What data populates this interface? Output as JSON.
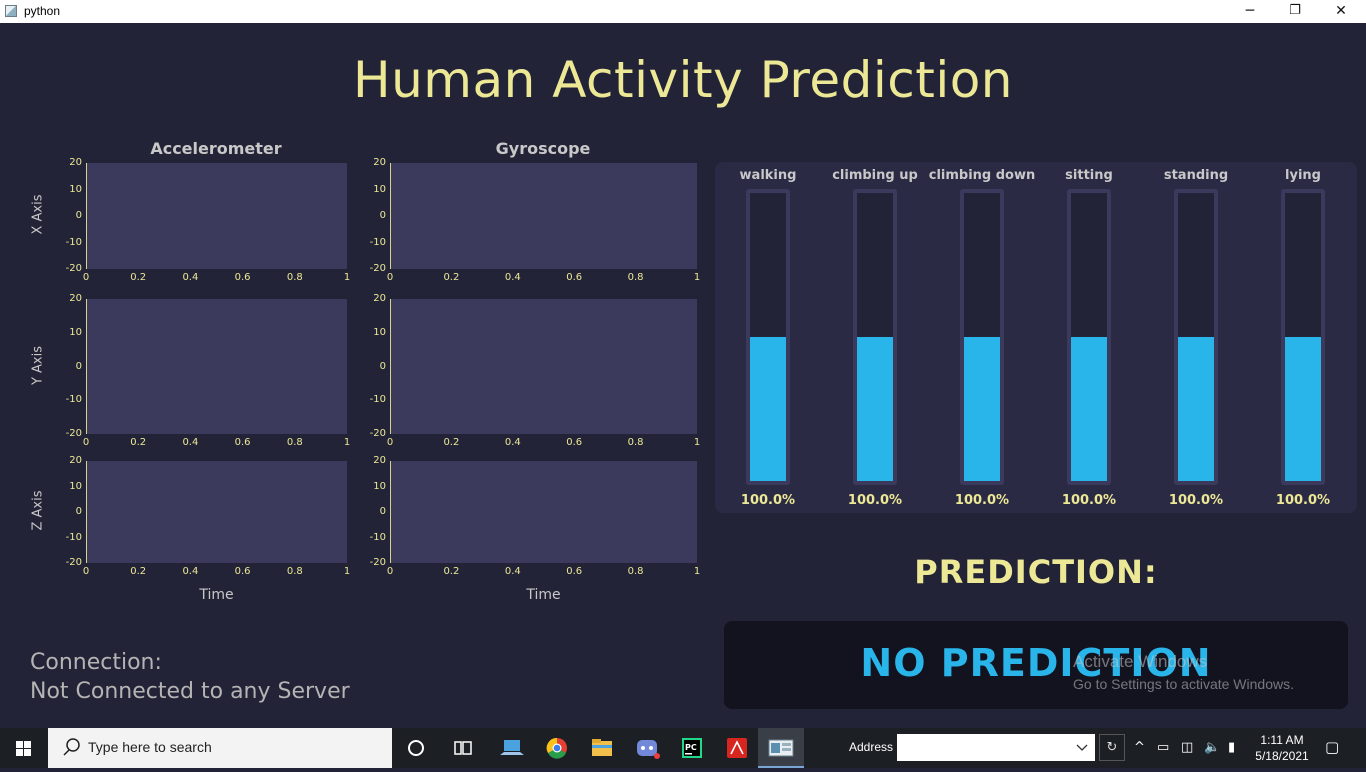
{
  "window": {
    "title": "python",
    "minimize": "─",
    "maximize": "❐",
    "close": "✕"
  },
  "app": {
    "title": "Human Activity Prediction",
    "columns": [
      "Accelerometer",
      "Gyroscope"
    ],
    "axis_labels": [
      "X Axis",
      "Y Axis",
      "Z Axis"
    ],
    "xlabel": "Time",
    "xticks": [
      "0",
      "0.2",
      "0.4",
      "0.6",
      "0.8",
      "1"
    ],
    "yticks": [
      "20",
      "10",
      "0",
      "-10",
      "-20"
    ],
    "activities": [
      {
        "label": "walking",
        "value": 100.0,
        "pct": "100.0%"
      },
      {
        "label": "climbing up",
        "value": 100.0,
        "pct": "100.0%"
      },
      {
        "label": "climbing down",
        "value": 100.0,
        "pct": "100.0%"
      },
      {
        "label": "sitting",
        "value": 100.0,
        "pct": "100.0%"
      },
      {
        "label": "standing",
        "value": 100.0,
        "pct": "100.0%"
      },
      {
        "label": "lying",
        "value": 100.0,
        "pct": "100.0%"
      }
    ],
    "bar_visible_fill_fraction": 0.5,
    "prediction_heading": "PREDICTION:",
    "prediction_value": "NO PREDICTION",
    "connection_label": "Connection:",
    "connection_status": "Not Connected to any Server",
    "colors": {
      "background": "#232338",
      "plot_bg": "#3b3a5c",
      "accent_yellow": "#ece895",
      "bar_blue": "#29b5ea"
    }
  },
  "watermark": {
    "line1": "Activate Windows",
    "line2": "Go to Settings to activate Windows."
  },
  "taskbar": {
    "search_placeholder": "Type here to search",
    "address_label": "Address",
    "time": "1:11 AM",
    "date": "5/18/2021",
    "apps": [
      "cortana-icon",
      "task-view-icon",
      "laptop-icon",
      "chrome-icon",
      "file-explorer-icon",
      "discord-icon",
      "pycharm-icon",
      "acrobat-icon",
      "python-app-icon"
    ]
  }
}
